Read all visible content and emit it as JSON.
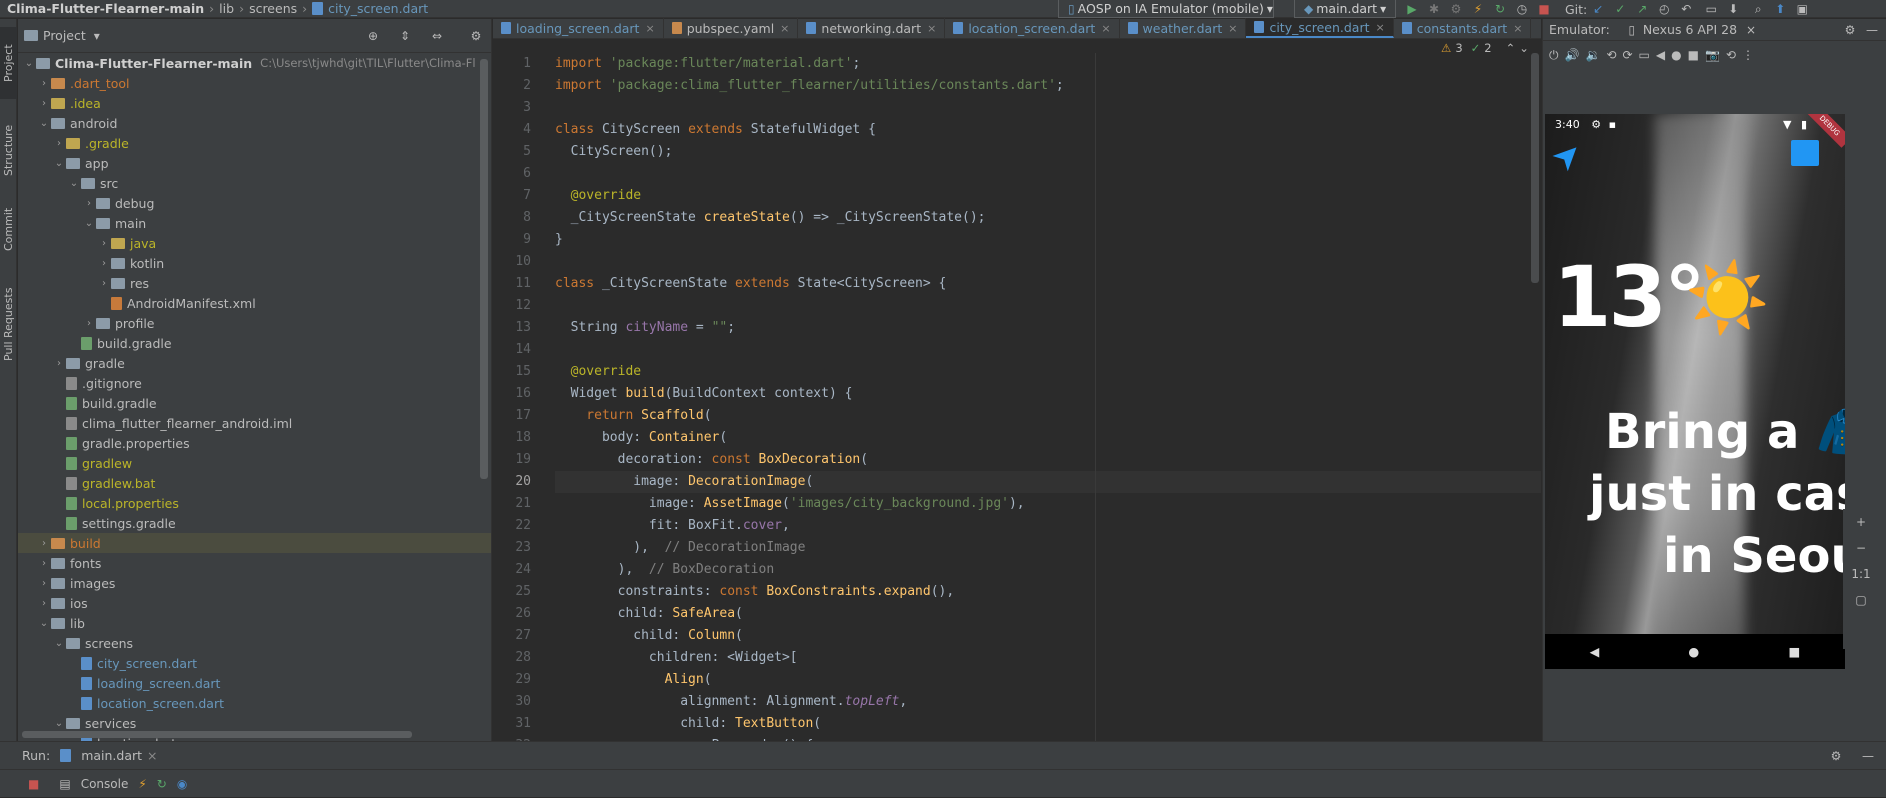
{
  "topbar": {
    "project": "Clima-Flutter-Flearner-main",
    "crumbs": [
      "lib",
      "screens"
    ],
    "file": "city_screen.dart",
    "device": "AOSP on IA Emulator (mobile)",
    "run_config": "main.dart",
    "git_label": "Git:"
  },
  "side_tabs": [
    "Project",
    "Structure",
    "Commit",
    "Pull Requests"
  ],
  "project_panel": {
    "title": "Project",
    "root_path": "C:\\Users\\tjwhd\\git\\TIL\\Flutter\\Clima-Fl",
    "tree": [
      {
        "depth": 0,
        "type": "folder",
        "name": "Clima-Flutter-Flearner-main",
        "open": true,
        "bold": true
      },
      {
        "depth": 1,
        "type": "folder",
        "name": ".dart_tool",
        "open": false,
        "color": "orange"
      },
      {
        "depth": 1,
        "type": "folder",
        "name": ".idea",
        "open": false,
        "color": "yellow"
      },
      {
        "depth": 1,
        "type": "folder",
        "name": "android",
        "open": true
      },
      {
        "depth": 2,
        "type": "folder",
        "name": ".gradle",
        "open": false,
        "color": "yellow"
      },
      {
        "depth": 2,
        "type": "folder",
        "name": "app",
        "open": true
      },
      {
        "depth": 3,
        "type": "folder",
        "name": "src",
        "open": true
      },
      {
        "depth": 4,
        "type": "folder",
        "name": "debug",
        "open": false
      },
      {
        "depth": 4,
        "type": "folder",
        "name": "main",
        "open": true
      },
      {
        "depth": 5,
        "type": "folder",
        "name": "java",
        "open": false,
        "color": "yellow"
      },
      {
        "depth": 5,
        "type": "folder",
        "name": "kotlin",
        "open": false
      },
      {
        "depth": 5,
        "type": "folder",
        "name": "res",
        "open": false
      },
      {
        "depth": 5,
        "type": "file",
        "name": "AndroidManifest.xml",
        "icon": "xml"
      },
      {
        "depth": 4,
        "type": "folder",
        "name": "profile",
        "open": false
      },
      {
        "depth": 3,
        "type": "file",
        "name": "build.gradle",
        "icon": "grad"
      },
      {
        "depth": 2,
        "type": "folder",
        "name": "gradle",
        "open": false
      },
      {
        "depth": 2,
        "type": "file",
        "name": ".gitignore",
        "icon": "git"
      },
      {
        "depth": 2,
        "type": "file",
        "name": "build.gradle",
        "icon": "grad"
      },
      {
        "depth": 2,
        "type": "file",
        "name": "clima_flutter_flearner_android.iml",
        "icon": "git"
      },
      {
        "depth": 2,
        "type": "file",
        "name": "gradle.properties",
        "icon": "grad"
      },
      {
        "depth": 2,
        "type": "file",
        "name": "gradlew",
        "icon": "grad",
        "color": "yellow"
      },
      {
        "depth": 2,
        "type": "file",
        "name": "gradlew.bat",
        "icon": "git",
        "color": "yellow"
      },
      {
        "depth": 2,
        "type": "file",
        "name": "local.properties",
        "icon": "grad",
        "color": "yellow"
      },
      {
        "depth": 2,
        "type": "file",
        "name": "settings.gradle",
        "icon": "grad"
      },
      {
        "depth": 1,
        "type": "folder",
        "name": "build",
        "open": false,
        "color": "orange",
        "selected": true
      },
      {
        "depth": 1,
        "type": "folder",
        "name": "fonts",
        "open": false
      },
      {
        "depth": 1,
        "type": "folder",
        "name": "images",
        "open": false
      },
      {
        "depth": 1,
        "type": "folder",
        "name": "ios",
        "open": false
      },
      {
        "depth": 1,
        "type": "folder",
        "name": "lib",
        "open": true
      },
      {
        "depth": 2,
        "type": "folder",
        "name": "screens",
        "open": true
      },
      {
        "depth": 3,
        "type": "file",
        "name": "city_screen.dart",
        "icon": "dart",
        "color": "blue"
      },
      {
        "depth": 3,
        "type": "file",
        "name": "loading_screen.dart",
        "icon": "dart",
        "color": "blue"
      },
      {
        "depth": 3,
        "type": "file",
        "name": "location_screen.dart",
        "icon": "dart",
        "color": "blue"
      },
      {
        "depth": 2,
        "type": "folder",
        "name": "services",
        "open": true
      },
      {
        "depth": 3,
        "type": "file",
        "name": "location.dart",
        "icon": "dart"
      }
    ]
  },
  "editor": {
    "tabs": [
      {
        "name": "loading_screen.dart",
        "icon": "dart",
        "active": false,
        "color": "blue"
      },
      {
        "name": "pubspec.yaml",
        "icon": "yaml",
        "active": false
      },
      {
        "name": "networking.dart",
        "icon": "dart",
        "active": false
      },
      {
        "name": "location_screen.dart",
        "icon": "dart",
        "active": false,
        "color": "blue"
      },
      {
        "name": "weather.dart",
        "icon": "dart",
        "active": false,
        "color": "blue"
      },
      {
        "name": "city_screen.dart",
        "icon": "dart",
        "active": true
      },
      {
        "name": "constants.dart",
        "icon": "dart",
        "active": false,
        "color": "blue"
      }
    ],
    "warnings": "3",
    "checks": "2",
    "current_line": 20,
    "lines": [
      [
        [
          "kw",
          "import "
        ],
        [
          "str",
          "'package:flutter/material.dart'"
        ],
        [
          "cls",
          ";"
        ]
      ],
      [
        [
          "kw",
          "import "
        ],
        [
          "str",
          "'package:clima_flutter_flearner/utilities/constants.dart'"
        ],
        [
          "cls",
          ";"
        ]
      ],
      [],
      [
        [
          "kw",
          "class "
        ],
        [
          "cls",
          "CityScreen "
        ],
        [
          "kw",
          "extends "
        ],
        [
          "cls",
          "StatefulWidget {"
        ]
      ],
      [
        [
          "cls",
          "  CityScreen();"
        ]
      ],
      [],
      [
        [
          "ann",
          "  @override"
        ]
      ],
      [
        [
          "cls",
          "  _CityScreenState "
        ],
        [
          "fn",
          "createState"
        ],
        [
          "cls",
          "() => _CityScreenState();"
        ]
      ],
      [
        [
          "cls",
          "}"
        ]
      ],
      [],
      [
        [
          "kw",
          "class "
        ],
        [
          "cls",
          "_CityScreenState "
        ],
        [
          "kw",
          "extends "
        ],
        [
          "cls",
          "State<CityScreen> {"
        ]
      ],
      [],
      [
        [
          "cls",
          "  String "
        ],
        [
          "pp",
          "cityName"
        ],
        [
          "cls",
          " = "
        ],
        [
          "str",
          "\"\""
        ],
        [
          "cls",
          ";"
        ]
      ],
      [],
      [
        [
          "ann",
          "  @override"
        ]
      ],
      [
        [
          "cls",
          "  Widget "
        ],
        [
          "fn",
          "build"
        ],
        [
          "cls",
          "(BuildContext context) {"
        ]
      ],
      [
        [
          "kw",
          "    return "
        ],
        [
          "fn",
          "Scaffold"
        ],
        [
          "cls",
          "("
        ]
      ],
      [
        [
          "cls",
          "      body: "
        ],
        [
          "fn",
          "Container"
        ],
        [
          "cls",
          "("
        ]
      ],
      [
        [
          "cls",
          "        decoration: "
        ],
        [
          "kw",
          "const "
        ],
        [
          "fn",
          "BoxDecoration"
        ],
        [
          "cls",
          "("
        ]
      ],
      [
        [
          "cls",
          "          image: "
        ],
        [
          "fn",
          "DecorationImage"
        ],
        [
          "cls",
          "("
        ]
      ],
      [
        [
          "cls",
          "            image: "
        ],
        [
          "fn",
          "AssetImage"
        ],
        [
          "cls",
          "("
        ],
        [
          "str",
          "'images/city_background.jpg'"
        ],
        [
          "cls",
          "),"
        ]
      ],
      [
        [
          "cls",
          "            fit: BoxFit."
        ],
        [
          "pp",
          "cover"
        ],
        [
          "cls",
          ","
        ]
      ],
      [
        [
          "cls",
          "          ),  "
        ],
        [
          "cm",
          "// DecorationImage"
        ]
      ],
      [
        [
          "cls",
          "        ),  "
        ],
        [
          "cm",
          "// BoxDecoration"
        ]
      ],
      [
        [
          "cls",
          "        constraints: "
        ],
        [
          "kw",
          "const "
        ],
        [
          "fn",
          "BoxConstraints.expand"
        ],
        [
          "cls",
          "(),"
        ]
      ],
      [
        [
          "cls",
          "        child: "
        ],
        [
          "fn",
          "SafeArea"
        ],
        [
          "cls",
          "("
        ]
      ],
      [
        [
          "cls",
          "          child: "
        ],
        [
          "fn",
          "Column"
        ],
        [
          "cls",
          "("
        ]
      ],
      [
        [
          "cls",
          "            children: <Widget>["
        ]
      ],
      [
        [
          "cls",
          "              "
        ],
        [
          "fn",
          "Align"
        ],
        [
          "cls",
          "("
        ]
      ],
      [
        [
          "cls",
          "                alignment: Alignment."
        ],
        [
          "it",
          "topLeft"
        ],
        [
          "cls",
          ","
        ]
      ],
      [
        [
          "cls",
          "                child: "
        ],
        [
          "fn",
          "TextButton"
        ],
        [
          "cls",
          "("
        ]
      ],
      [
        [
          "cls",
          "                  onPressed: () {"
        ]
      ]
    ]
  },
  "emulator": {
    "title": "Emulator:",
    "device": "Nexus 6 API 28",
    "time": "3:40",
    "temp": "13°",
    "weather_icon": "☀️",
    "message_lines": [
      "Bring a 🧥",
      "just in case",
      "in Seoul"
    ],
    "debug_badge": "DEBUG",
    "zoom_label": "1:1"
  },
  "bottom": {
    "run_label": "Run:",
    "run_target": "main.dart",
    "console_label": "Console"
  }
}
